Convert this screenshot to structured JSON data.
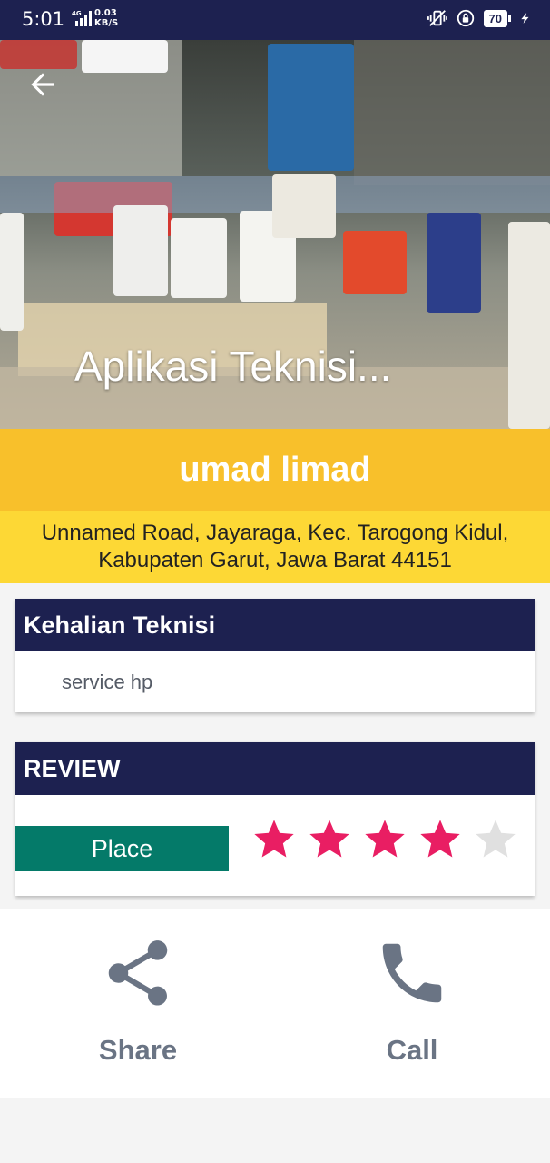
{
  "status_bar": {
    "time": "5:01",
    "network_label": "4G",
    "speed_value": "0.03",
    "speed_unit": "KB/S",
    "battery": "70"
  },
  "hero": {
    "title": "Aplikasi Teknisi...",
    "back_icon": "arrow-back-icon"
  },
  "technician": {
    "name": "umad limad",
    "address": "Unnamed Road, Jayaraga, Kec. Tarogong Kidul, Kabupaten Garut, Jawa Barat 44151"
  },
  "skills_card": {
    "title": "Kehalian Teknisi",
    "value": "service hp"
  },
  "review_card": {
    "title": "REVIEW",
    "place_label": "Place",
    "rating": 4,
    "max_rating": 5,
    "star_color": "#e91e63",
    "star_empty_color": "#e0e0e0"
  },
  "actions": {
    "share_label": "Share",
    "call_label": "Call"
  },
  "colors": {
    "navy": "#1d2150",
    "yellow_dark": "#f8c02b",
    "yellow_light": "#fdd835",
    "teal": "#047a69",
    "action_grey": "#6a7484"
  }
}
